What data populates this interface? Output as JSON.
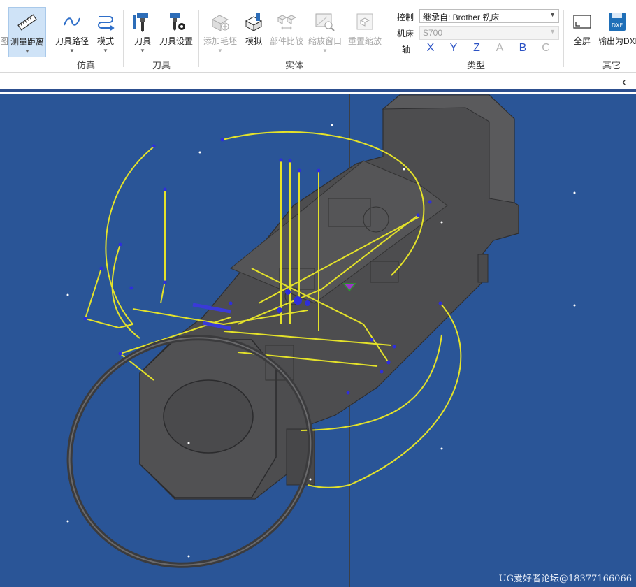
{
  "ribbon": {
    "cut_left_label": "图",
    "measure_label": "测量距离",
    "toolpath_label": "刀具路径",
    "mode_label": "模式",
    "tool_label": "刀具",
    "tool_settings_label": "刀具设置",
    "add_stock_label": "添加毛坯",
    "simulate_label": "模拟",
    "compare_label": "部件比较",
    "zoom_window_label": "缩放窗口",
    "reset_zoom_label": "重置缩放",
    "fullscreen_label": "全屏",
    "export_dxf_label": "输出为DXF",
    "dxf_badge": "DXF",
    "groups": {
      "simulation": "仿真",
      "tool": "刀具",
      "solid": "实体",
      "type": "类型",
      "other": "其它"
    },
    "control_label": "控制",
    "control_value": "继承自: Brother 铣床",
    "machine_label": "机床",
    "machine_value": "S700",
    "axis_label": "轴",
    "axes": [
      "X",
      "Y",
      "Z",
      "A",
      "B",
      "C"
    ]
  },
  "watermark": "UG爱好者论坛@18377166066",
  "colors": {
    "viewport_bg": "#2a5597",
    "toolpath": "#e4e22a",
    "point": "#2e2edc",
    "part": "#4d4d4f"
  }
}
